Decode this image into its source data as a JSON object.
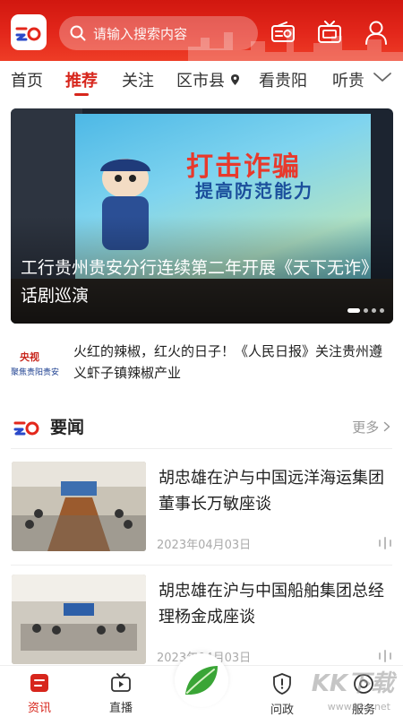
{
  "header": {
    "search_placeholder": "请输入搜索内容",
    "brand_color": "#d7261c"
  },
  "tabs": [
    {
      "label": "首页"
    },
    {
      "label": "推荐",
      "active": true
    },
    {
      "label": "关注"
    },
    {
      "label": "区市县"
    },
    {
      "label": "看贵阳"
    },
    {
      "label": "听贵"
    }
  ],
  "banner": {
    "title": "工行贵州贵安分行连续第二年开展《天下无诈》话剧巡演",
    "slogan_main": "打击诈骗",
    "slogan_sub": "提高防范能力",
    "slide_count": 4,
    "active_slide": 1
  },
  "brief": {
    "text": "火红的辣椒，红火的日子！《人民日报》关注贵州遵义虾子镇辣椒产业",
    "thumb_text_top": "央视",
    "thumb_text_bottom": "聚焦贵阳贵安"
  },
  "section": {
    "title": "要闻",
    "more": "更多"
  },
  "news": [
    {
      "title": "胡忠雄在沪与中国远洋海运集团董事长万敏座谈",
      "date": "2023年04月03日"
    },
    {
      "title": "胡忠雄在沪与中国船舶集团总经理杨金成座谈",
      "date": "2023年04月03日"
    }
  ],
  "bottom_nav": [
    {
      "label": "资讯",
      "icon": "news-icon",
      "active": true
    },
    {
      "label": "直播",
      "icon": "tv-icon"
    },
    {
      "label": "",
      "icon": "leaf-icon"
    },
    {
      "label": "问政",
      "icon": "shield-icon"
    },
    {
      "label": "服务",
      "icon": "service-icon"
    }
  ],
  "watermark": {
    "main": "KK下载",
    "sub": "www.kkx.net"
  }
}
